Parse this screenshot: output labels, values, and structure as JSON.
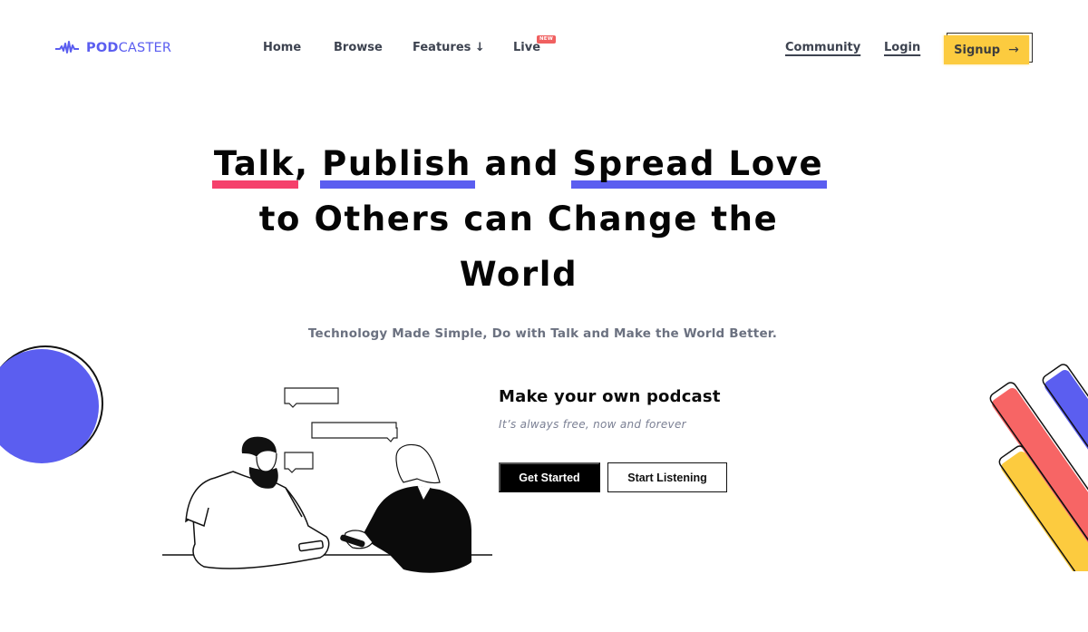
{
  "brand": {
    "name_bold": "POD",
    "name_regular": "CASTER",
    "logo_icon": "soundwave-icon",
    "color": "#5b5ef0"
  },
  "nav": {
    "links": [
      {
        "label": "Home"
      },
      {
        "label": "Browse"
      },
      {
        "label": "Features ↓"
      },
      {
        "label": "Live",
        "badge": "NEW"
      }
    ],
    "right_links": [
      {
        "label": "Community"
      },
      {
        "label": "Login"
      }
    ],
    "signup": {
      "label": "Signup",
      "icon": "→"
    }
  },
  "hero": {
    "title_line1": {
      "parts": [
        {
          "text": "Talk",
          "highlight": "pink"
        },
        {
          "text": ", "
        },
        {
          "text": "Publish",
          "highlight": "blue"
        },
        {
          "text": " and "
        },
        {
          "text": "Spread Love",
          "highlight": "blue"
        }
      ]
    },
    "title_line2": "to Others can Change the",
    "title_line3": "World",
    "subtitle": "Technology Made Simple, Do with Talk and Make the World Better."
  },
  "cta": {
    "title": "Make your own podcast",
    "subtitle": "It’s always free, now and forever",
    "primary_button": "Get Started",
    "secondary_button": "Start Listening"
  },
  "colors": {
    "pink": "#f5406b",
    "blue": "#5b5ef0",
    "yellow": "#fccb3f",
    "coral": "#f76565",
    "badge": "#f06060"
  }
}
